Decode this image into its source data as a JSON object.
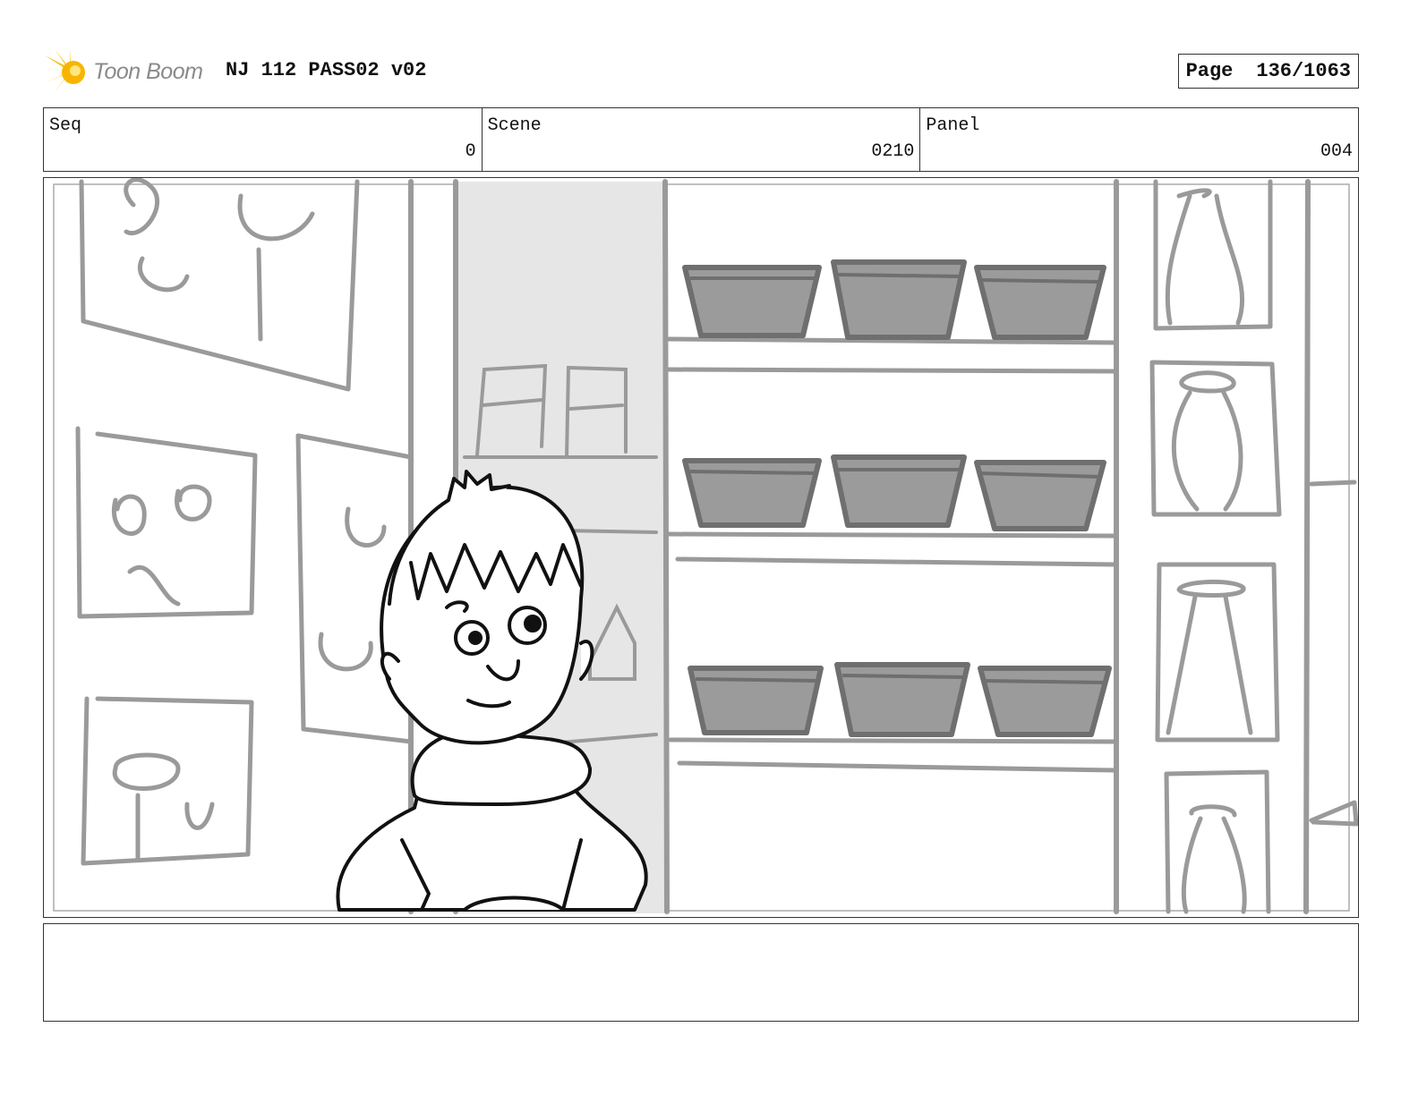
{
  "header": {
    "logo_text": "Toon Boom",
    "title": "NJ 112 PASS02 v02",
    "page_label": "Page",
    "page_number": "136/1063"
  },
  "info": {
    "seq_label": "Seq",
    "seq_value": "0",
    "scene_label": "Scene",
    "scene_value": "0210",
    "panel_label": "Panel",
    "panel_value": "004"
  },
  "panel": {
    "logo_color": "#f5c518",
    "sketch_gray": "#9a9a9a",
    "bowl_gray": "#9b9b9b",
    "bowl_dark": "#6f6f6f",
    "column_fill": "#e6e6e6",
    "line_black": "#111111"
  },
  "notes": {
    "text": ""
  }
}
